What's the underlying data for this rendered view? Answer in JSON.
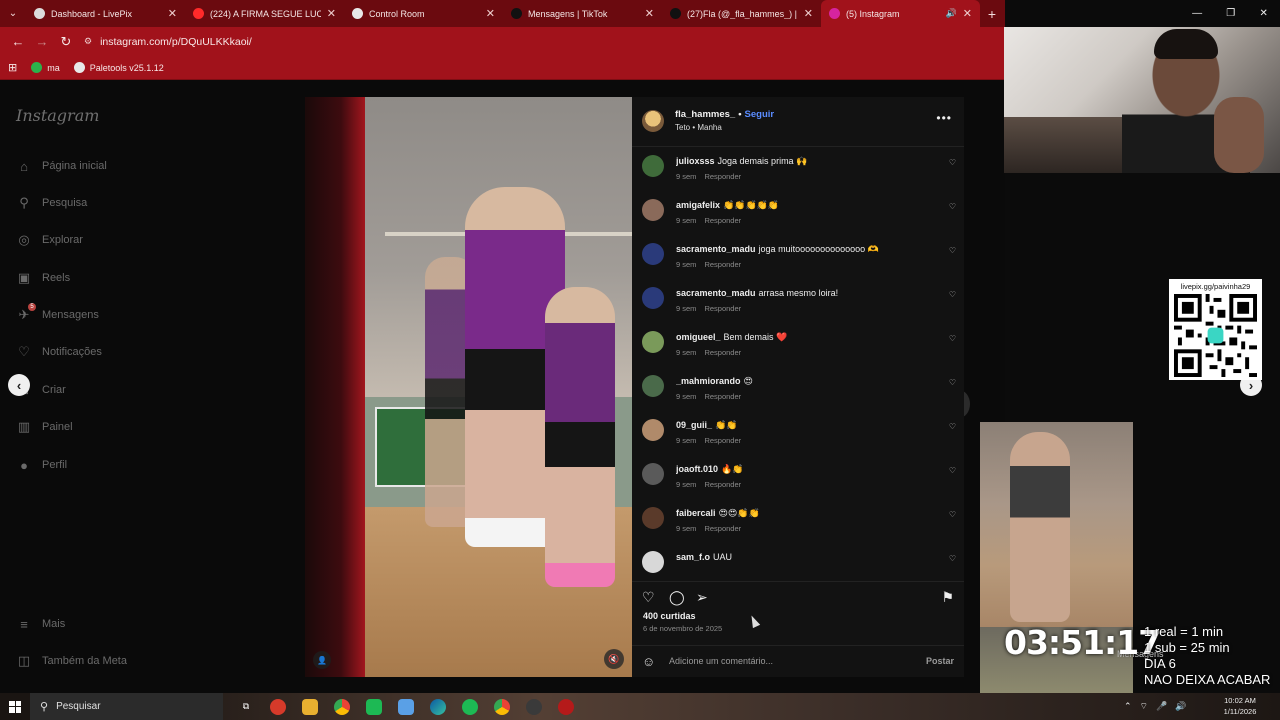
{
  "browser": {
    "tabs": [
      {
        "label": "Dashboard - LivePix",
        "icon_color": "#dcdcdc",
        "active": false
      },
      {
        "label": "(224) A FIRMA SEGUE LUCRANDO",
        "icon_color": "#ff2a2a",
        "active": false
      },
      {
        "label": "Control Room",
        "icon_color": "#e8e8e8",
        "active": false
      },
      {
        "label": "Mensagens | TikTok",
        "icon_color": "#111111",
        "active": false
      },
      {
        "label": "(27)Fla (@_fla_hammes_) | TikTok",
        "icon_color": "#111111",
        "active": false
      },
      {
        "label": "(5) Instagram",
        "icon_color": "#d6249f",
        "active": true
      }
    ],
    "new_tab_label": "+",
    "url": "instagram.com/p/DQuULKKkaoi/",
    "bookmarks": [
      {
        "label": "ma",
        "icon_color": "#2bb24c"
      },
      {
        "label": "Paletools v25.1.12",
        "icon_color": "#e8e8e8"
      }
    ],
    "accent": "#a1121b",
    "tab_strip_color": "#6b0a0f"
  },
  "instagram": {
    "logo": "Instagram",
    "sidebar": [
      {
        "label": "Página inicial",
        "icon": "home-icon",
        "glyph": "⌂"
      },
      {
        "label": "Pesquisa",
        "icon": "search-icon",
        "glyph": "⚲"
      },
      {
        "label": "Explorar",
        "icon": "compass-icon",
        "glyph": "◎"
      },
      {
        "label": "Reels",
        "icon": "reels-icon",
        "glyph": "▣"
      },
      {
        "label": "Mensagens",
        "icon": "messages-icon",
        "glyph": "✈",
        "badge": "5"
      },
      {
        "label": "Notificações",
        "icon": "heart-icon",
        "glyph": "♡"
      },
      {
        "label": "Criar",
        "icon": "create-icon",
        "glyph": "⊞"
      },
      {
        "label": "Painel",
        "icon": "dashboard-icon",
        "glyph": "▥"
      },
      {
        "label": "Perfil",
        "icon": "profile-icon",
        "glyph": "●"
      },
      {
        "label": "Mais",
        "icon": "menu-icon",
        "glyph": "≡"
      },
      {
        "label": "Também da Meta",
        "icon": "meta-icon",
        "glyph": "◫"
      }
    ],
    "post": {
      "username": "fla_hammes_",
      "separator": "•",
      "follow_label": "Seguir",
      "location": "Teto • Manha",
      "likes": "400 curtidas",
      "date": "6 de novembro de 2025",
      "comment_placeholder": "Adicione um comentário...",
      "post_label": "Postar",
      "comments": [
        {
          "user": "julioxsss",
          "text": "Joga demais prima 🙌",
          "time": "9 sem",
          "reply": "Responder",
          "avatar_color": "#3f6b3a"
        },
        {
          "user": "amigafelix",
          "text": "👏👏👏👏👏",
          "time": "9 sem",
          "reply": "Responder",
          "avatar_color": "#8a6a5a"
        },
        {
          "user": "sacramento_madu",
          "text": "joga muitoooooooooooooo 🫶",
          "time": "9 sem",
          "reply": "Responder",
          "avatar_color": "#2a3a7a"
        },
        {
          "user": "sacramento_madu",
          "text": "arrasa mesmo loira!",
          "time": "9 sem",
          "reply": "Responder",
          "avatar_color": "#2a3a7a"
        },
        {
          "user": "omigueel_",
          "text": "Bem demais ❤️",
          "time": "9 sem",
          "reply": "Responder",
          "avatar_color": "#7a9a5a"
        },
        {
          "user": "_mahmiorando",
          "text": "😍",
          "time": "9 sem",
          "reply": "Responder",
          "avatar_color": "#4a6a4a"
        },
        {
          "user": "09_guii_",
          "text": "👏👏",
          "time": "9 sem",
          "reply": "Responder",
          "avatar_color": "#b08a6a"
        },
        {
          "user": "joaoft.010",
          "text": "🔥👏",
          "time": "9 sem",
          "reply": "Responder",
          "avatar_color": "#5a5a5a"
        },
        {
          "user": "faibercali",
          "text": "😍😍👏👏",
          "time": "9 sem",
          "reply": "Responder",
          "avatar_color": "#5a3a2a"
        },
        {
          "user": "sam_f.o",
          "text": "UAU",
          "time": "",
          "reply": "",
          "avatar_color": "#d8d8d8"
        }
      ]
    }
  },
  "stream": {
    "qr_label": "livepix.gg/paivinha29",
    "timer": "03:51:17",
    "lines": [
      "1 real = 1 min",
      "1 sub = 25 min",
      "DIA 6",
      "NAO DEIXA ACABAR"
    ],
    "background_label": "Mensagens"
  },
  "taskbar": {
    "search_label": "Pesquisar",
    "time": "10:02 AM",
    "date": "1/11/2026"
  }
}
